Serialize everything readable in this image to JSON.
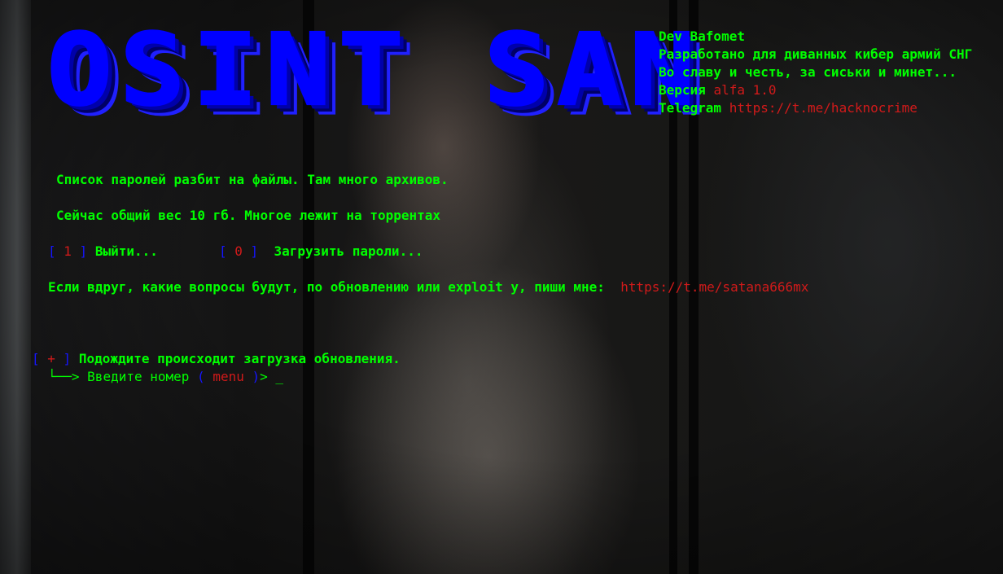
{
  "logo": {
    "text": "OSINT SAN"
  },
  "info": {
    "dev": "Dev Bafomet",
    "developed_for": "Разработано для диванных кибер армий СНГ",
    "motto": "Во славу и честь, за сиськи и минет...",
    "version_label": "Версия",
    "version_value": "alfa 1.0",
    "telegram_label": "Telegram",
    "telegram_link": "https://t.me/hacknocrime"
  },
  "messages": {
    "passwords_split": "Список паролей разбит на файлы. Там много архивов.",
    "total_size": "Сейчас общий вес 10 гб. Многое лежит на торрентах"
  },
  "menu": {
    "items": [
      {
        "key": "1",
        "label": "Выйти..."
      },
      {
        "key": "0",
        "label": "Загрузить пароли..."
      }
    ]
  },
  "contact": {
    "text": "Если вдруг, какие вопросы будут, по обновлению или exploit у, пиши мне:",
    "link": "https://t.me/satana666mx"
  },
  "status": {
    "marker": "+",
    "message": "Подождите происходит загрузка обновления."
  },
  "prompt": {
    "arrow": "└──>",
    "label": "Введите номер",
    "context": "menu",
    "suffix": ">",
    "cursor": "_"
  },
  "colors": {
    "primary_text": "#00ff00",
    "accent_link": "#d11a1a",
    "bracket": "#1515ff",
    "logo": "#0000ff"
  }
}
